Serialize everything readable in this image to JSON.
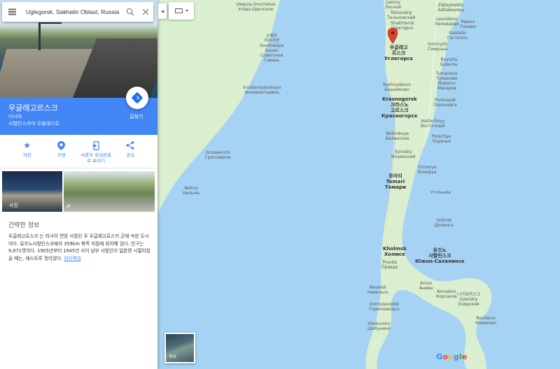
{
  "search": {
    "value": "Uglegorsk, Sakhalin Oblast, Russia"
  },
  "place": {
    "name": "우글레고르스크",
    "country": "러시아",
    "region": "사할린스카야 오블래스트",
    "directions_label": "길찾기"
  },
  "actions": [
    {
      "label": "저장",
      "icon": "star-icon"
    },
    {
      "label": "주변",
      "icon": "nearby-icon"
    },
    {
      "label": "사용자 휴대전화로 보내기",
      "icon": "send-to-phone-icon"
    },
    {
      "label": "공유",
      "icon": "share-icon"
    }
  ],
  "photos": {
    "label": "사진"
  },
  "about": {
    "title": "간략한 정보",
    "text": "우글레고르스크 는 러시아 연방 사할린 주 우글레고르스키 군에 속한 도시이다. 유즈노사할린스크에서 359km 북쪽 지점에 위치해 있다. 인구는 9,871명이다. 1905년부터 1945년 사이 남부 사할린이 일본령 시절이었을 때는, 에스토루 정이었다.",
    "link": "위키백과"
  },
  "map": {
    "satellite_label": "위성",
    "logo": [
      "G",
      "o",
      "o",
      "g",
      "l",
      "e"
    ],
    "colors": {
      "water": "#a6d3f3",
      "land": "#d9efcf",
      "marker": "#db4437"
    },
    "labels": [
      {
        "id": "uleguia",
        "lines": [
          "Uleguia-Orochskoe",
          "Усква-Орочское"
        ]
      },
      {
        "id": "sovetskaya",
        "lines": [
          "소베츠",
          "카야가반",
          "Sovetskaya",
          "Gavan",
          "Советская",
          "Гавань"
        ]
      },
      {
        "id": "innokentevka",
        "lines": [
          "Innokentyevskaya",
          "Иннокентьевка"
        ]
      },
      {
        "id": "grossevichi",
        "lines": [
          "Grossevichi",
          "Гроссевичи"
        ]
      },
      {
        "id": "nelma",
        "lines": [
          "Nelma",
          "Нельма"
        ]
      },
      {
        "id": "lesnoy",
        "lines": [
          "Lesnoy",
          "Лесной"
        ]
      },
      {
        "id": "telnovskiy",
        "lines": [
          "Telnovskiy",
          "Тельновский"
        ]
      },
      {
        "id": "shakhtersk",
        "lines": [
          "Shakhtersk",
          "Шахтерск"
        ]
      },
      {
        "id": "uglegorsk",
        "lines": [
          "우글레고",
          "르스크",
          "Углегорск"
        ]
      },
      {
        "id": "boshnyakovo",
        "lines": [
          "Boshnyakovo",
          "Бошняково"
        ]
      },
      {
        "id": "krasnogorsk",
        "lines": [
          "Krasnogorsk",
          "크라스노",
          "고르스크",
          "Красногорск"
        ]
      },
      {
        "id": "belinskoe",
        "lines": [
          "Belinskoye",
          "Белинское"
        ]
      },
      {
        "id": "ilyinskiy",
        "lines": [
          "Ilyinskiy",
          "Ильинский"
        ]
      },
      {
        "id": "tomari",
        "lines": [
          "토마리",
          "Tomari",
          "Томари"
        ]
      },
      {
        "id": "kholmsk",
        "lines": [
          "Kholmsk",
          "Холмск"
        ]
      },
      {
        "id": "pravda",
        "lines": [
          "Pravda",
          "Правда"
        ]
      },
      {
        "id": "nevelsk",
        "lines": [
          "Nevelsk",
          "Невельск"
        ]
      },
      {
        "id": "gornozavodsk",
        "lines": [
          "Gornozavodsk",
          "Горнозаводск"
        ]
      },
      {
        "id": "shebunino",
        "lines": [
          "Shebunino",
          "Шебунино"
        ]
      },
      {
        "id": "aniva",
        "lines": [
          "Aniva",
          "Анива"
        ]
      },
      {
        "id": "korsakov",
        "lines": [
          "Korsakov",
          "Корсаков"
        ]
      },
      {
        "id": "ozerskiy",
        "lines": [
          "나거흑커스크",
          "Ozerskiy",
          "Озерский"
        ]
      },
      {
        "id": "novikovo",
        "lines": [
          "Novikovo",
          "Новиково"
        ]
      },
      {
        "id": "yuzhno",
        "lines": [
          "유즈노",
          "사할린스크",
          "Южно-Сахалинск"
        ],
        "big": true
      },
      {
        "id": "dolinsk",
        "lines": [
          "Dolinsk",
          "Долинск"
        ]
      },
      {
        "id": "vzmorye",
        "lines": [
          "Vzmorye",
          "Взморье"
        ]
      },
      {
        "id": "vostochnoye",
        "lines": [
          "Vostochnyy",
          "Восточный"
        ]
      },
      {
        "id": "poronaysk",
        "lines": [
          "Poronaysk",
          "Поронайск"
        ]
      },
      {
        "id": "makarov",
        "lines": [
          "Tumanovo",
          "Туманово",
          "Makarov",
          "Макаров"
        ]
      },
      {
        "id": "leonidovo",
        "lines": [
          "Leonidovo",
          "Леонидово"
        ]
      },
      {
        "id": "zabaykalets",
        "lines": [
          "Zabaykalets",
          "Забайкалец"
        ]
      },
      {
        "id": "gastello",
        "lines": [
          "Gastello",
          "Гастелло"
        ]
      },
      {
        "id": "smirnykh",
        "lines": [
          "Smirnykh",
          "Смирных"
        ]
      },
      {
        "id": "buyukly",
        "lines": [
          "Buyukly",
          "Буюклы"
        ]
      },
      {
        "id": "palevo",
        "lines": [
          "Palevo",
          "Палево"
        ]
      },
      {
        "id": "porechye",
        "lines": [
          "Porechye",
          "Поречье"
        ]
      },
      {
        "id": "ugolnoye",
        "lines": [
          "Угольное"
        ]
      }
    ]
  }
}
